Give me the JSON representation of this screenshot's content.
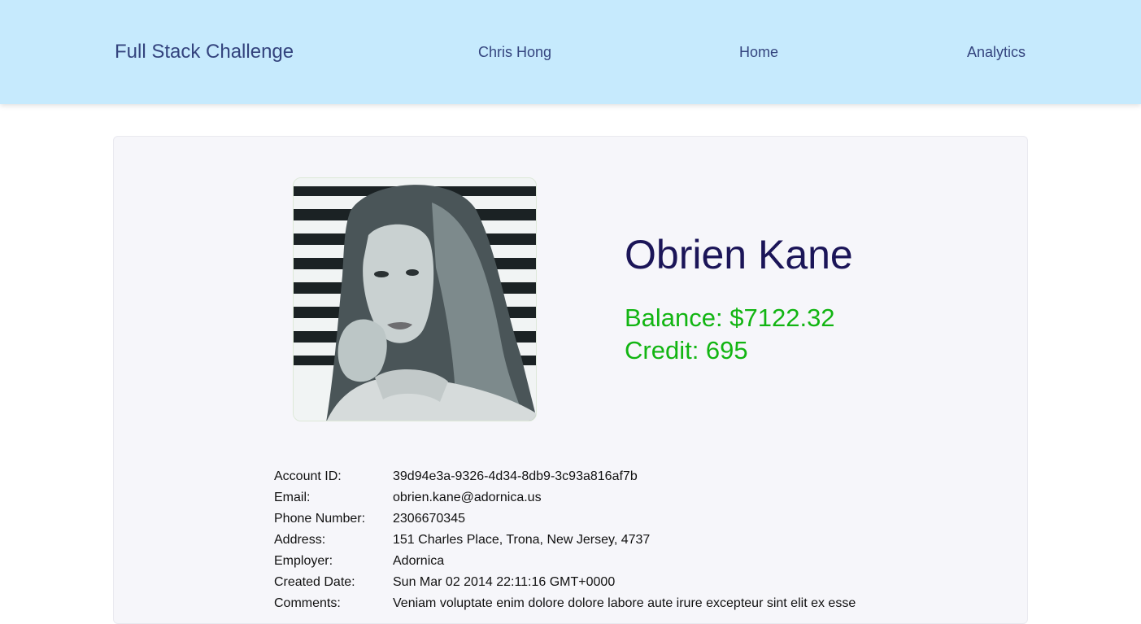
{
  "header": {
    "brand": "Full Stack Challenge",
    "nav": {
      "user": "Chris Hong",
      "home": "Home",
      "analytics": "Analytics"
    },
    "background_color": "#c6eafd",
    "text_color": "#34447e"
  },
  "profile": {
    "avatar_icon": "profile-photo",
    "name": "Obrien Kane",
    "balance": "Balance: $7122.32",
    "credit": "Credit: 695",
    "name_color": "#1b1558",
    "accent_color": "#12b512"
  },
  "details": [
    {
      "label": "Account ID:",
      "value": "39d94e3a-9326-4d34-8db9-3c93a816af7b"
    },
    {
      "label": "Email:",
      "value": "obrien.kane@adornica.us"
    },
    {
      "label": "Phone Number:",
      "value": "2306670345"
    },
    {
      "label": "Address:",
      "value": "151 Charles Place, Trona, New Jersey, 4737"
    },
    {
      "label": "Employer:",
      "value": "Adornica"
    },
    {
      "label": "Created Date:",
      "value": "Sun Mar 02 2014 22:11:16 GMT+0000"
    },
    {
      "label": "Comments:",
      "value": "Veniam voluptate enim dolore dolore labore aute irure excepteur sint elit ex esse"
    }
  ]
}
